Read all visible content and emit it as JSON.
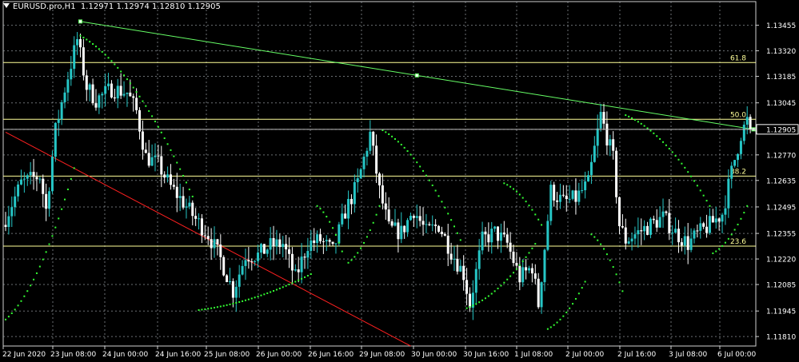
{
  "title": {
    "symbol": "EURUSD.pro,H1",
    "ohlc": "1.12971 1.12974 1.12810 1.12905"
  },
  "colors": {
    "background": "#000000",
    "grid": "#9aa0a6",
    "bull": "#26c6c6",
    "bear": "#ffffff",
    "psar": "#33ff33",
    "fib": "#ffff99",
    "trend_upper": "#66ff66",
    "trend_lower": "#ff2020",
    "axis_text": "#ffffff"
  },
  "price_axis": {
    "min": 1.1176,
    "max": 1.1358,
    "ticks": [
      "1.13455",
      "1.13320",
      "1.13185",
      "1.13045",
      "1.12905",
      "1.12770",
      "1.12635",
      "1.12495",
      "1.12355",
      "1.12220",
      "1.12085",
      "1.11945",
      "1.11810"
    ],
    "current_price": "1.12905"
  },
  "time_axis": {
    "labels": [
      "22 Jun 2020",
      "23 Jun 08:00",
      "24 Jun 00:00",
      "24 Jun 16:00",
      "25 Jun 08:00",
      "26 Jun 00:00",
      "26 Jun 16:00",
      "29 Jun 08:00",
      "30 Jun 00:00",
      "30 Jun 16:00",
      "1 Jul 08:00",
      "2 Jul 00:00",
      "2 Jul 16:00",
      "3 Jul 08:00",
      "6 Jul 00:00"
    ]
  },
  "fib_levels": [
    {
      "label": "61.8",
      "price": 1.13258
    },
    {
      "label": "50.0",
      "price": 1.12958
    },
    {
      "label": "38.2",
      "price": 1.12658
    },
    {
      "label": "23.6",
      "price": 1.12288
    }
  ],
  "chart_data": {
    "type": "candlestick",
    "anchors": [
      {
        "i": 0,
        "p": 1.124
      },
      {
        "i": 6,
        "p": 1.1262
      },
      {
        "i": 12,
        "p": 1.1266
      },
      {
        "i": 14,
        "p": 1.1248
      },
      {
        "i": 17,
        "p": 1.129
      },
      {
        "i": 20,
        "p": 1.1312
      },
      {
        "i": 24,
        "p": 1.1338
      },
      {
        "i": 27,
        "p": 1.1313
      },
      {
        "i": 30,
        "p": 1.1306
      },
      {
        "i": 35,
        "p": 1.1312
      },
      {
        "i": 40,
        "p": 1.131
      },
      {
        "i": 43,
        "p": 1.13
      },
      {
        "i": 46,
        "p": 1.1276
      },
      {
        "i": 50,
        "p": 1.1272
      },
      {
        "i": 54,
        "p": 1.126
      },
      {
        "i": 58,
        "p": 1.1252
      },
      {
        "i": 62,
        "p": 1.1243
      },
      {
        "i": 66,
        "p": 1.1235
      },
      {
        "i": 70,
        "p": 1.1222
      },
      {
        "i": 74,
        "p": 1.1205
      },
      {
        "i": 78,
        "p": 1.1224
      },
      {
        "i": 82,
        "p": 1.1224
      },
      {
        "i": 86,
        "p": 1.1229
      },
      {
        "i": 90,
        "p": 1.123
      },
      {
        "i": 94,
        "p": 1.1212
      },
      {
        "i": 98,
        "p": 1.123
      },
      {
        "i": 102,
        "p": 1.1232
      },
      {
        "i": 106,
        "p": 1.1226
      },
      {
        "i": 110,
        "p": 1.1247
      },
      {
        "i": 114,
        "p": 1.1262
      },
      {
        "i": 118,
        "p": 1.1288
      },
      {
        "i": 121,
        "p": 1.1258
      },
      {
        "i": 124,
        "p": 1.1238
      },
      {
        "i": 128,
        "p": 1.1236
      },
      {
        "i": 132,
        "p": 1.1248
      },
      {
        "i": 136,
        "p": 1.1236
      },
      {
        "i": 140,
        "p": 1.124
      },
      {
        "i": 144,
        "p": 1.1226
      },
      {
        "i": 148,
        "p": 1.1214
      },
      {
        "i": 150,
        "p": 1.1198
      },
      {
        "i": 154,
        "p": 1.1232
      },
      {
        "i": 158,
        "p": 1.1236
      },
      {
        "i": 162,
        "p": 1.123
      },
      {
        "i": 166,
        "p": 1.1212
      },
      {
        "i": 170,
        "p": 1.1218
      },
      {
        "i": 172,
        "p": 1.1198
      },
      {
        "i": 176,
        "p": 1.1258
      },
      {
        "i": 180,
        "p": 1.1252
      },
      {
        "i": 184,
        "p": 1.1254
      },
      {
        "i": 188,
        "p": 1.1262
      },
      {
        "i": 192,
        "p": 1.1298
      },
      {
        "i": 196,
        "p": 1.1275
      },
      {
        "i": 198,
        "p": 1.124
      },
      {
        "i": 200,
        "p": 1.1232
      },
      {
        "i": 204,
        "p": 1.1236
      },
      {
        "i": 208,
        "p": 1.124
      },
      {
        "i": 212,
        "p": 1.1244
      },
      {
        "i": 216,
        "p": 1.1236
      },
      {
        "i": 220,
        "p": 1.123
      },
      {
        "i": 223,
        "p": 1.1235
      },
      {
        "i": 227,
        "p": 1.124
      },
      {
        "i": 231,
        "p": 1.1246
      },
      {
        "i": 234,
        "p": 1.1268
      },
      {
        "i": 237,
        "p": 1.1288
      },
      {
        "i": 239,
        "p": 1.1295
      },
      {
        "i": 240,
        "p": 1.12905
      }
    ],
    "psar_segments": [
      {
        "from": 0,
        "to": 22,
        "start": 1.119,
        "end": 1.127
      },
      {
        "from": 24,
        "to": 60,
        "start": 1.134,
        "end": 1.1255
      },
      {
        "from": 62,
        "to": 98,
        "start": 1.1195,
        "end": 1.1214
      },
      {
        "from": 100,
        "to": 108,
        "start": 1.125,
        "end": 1.1226
      },
      {
        "from": 110,
        "to": 120,
        "start": 1.122,
        "end": 1.125
      },
      {
        "from": 121,
        "to": 146,
        "start": 1.129,
        "end": 1.1232
      },
      {
        "from": 148,
        "to": 170,
        "start": 1.1196,
        "end": 1.123
      },
      {
        "from": 160,
        "to": 172,
        "start": 1.1262,
        "end": 1.124
      },
      {
        "from": 174,
        "to": 186,
        "start": 1.1185,
        "end": 1.121
      },
      {
        "from": 188,
        "to": 198,
        "start": 1.1235,
        "end": 1.1205
      },
      {
        "from": 199,
        "to": 226,
        "start": 1.1298,
        "end": 1.125
      },
      {
        "from": 227,
        "to": 238,
        "start": 1.1225,
        "end": 1.125
      }
    ],
    "trendlines": [
      {
        "name": "upper",
        "from_i": 24,
        "from_p": 1.13475,
        "to_i": 240,
        "to_p": 1.12905
      },
      {
        "name": "lower",
        "from_i": 0,
        "from_p": 1.1289,
        "to_i": 130,
        "to_p": 1.1176
      }
    ],
    "candle_count": 240
  }
}
